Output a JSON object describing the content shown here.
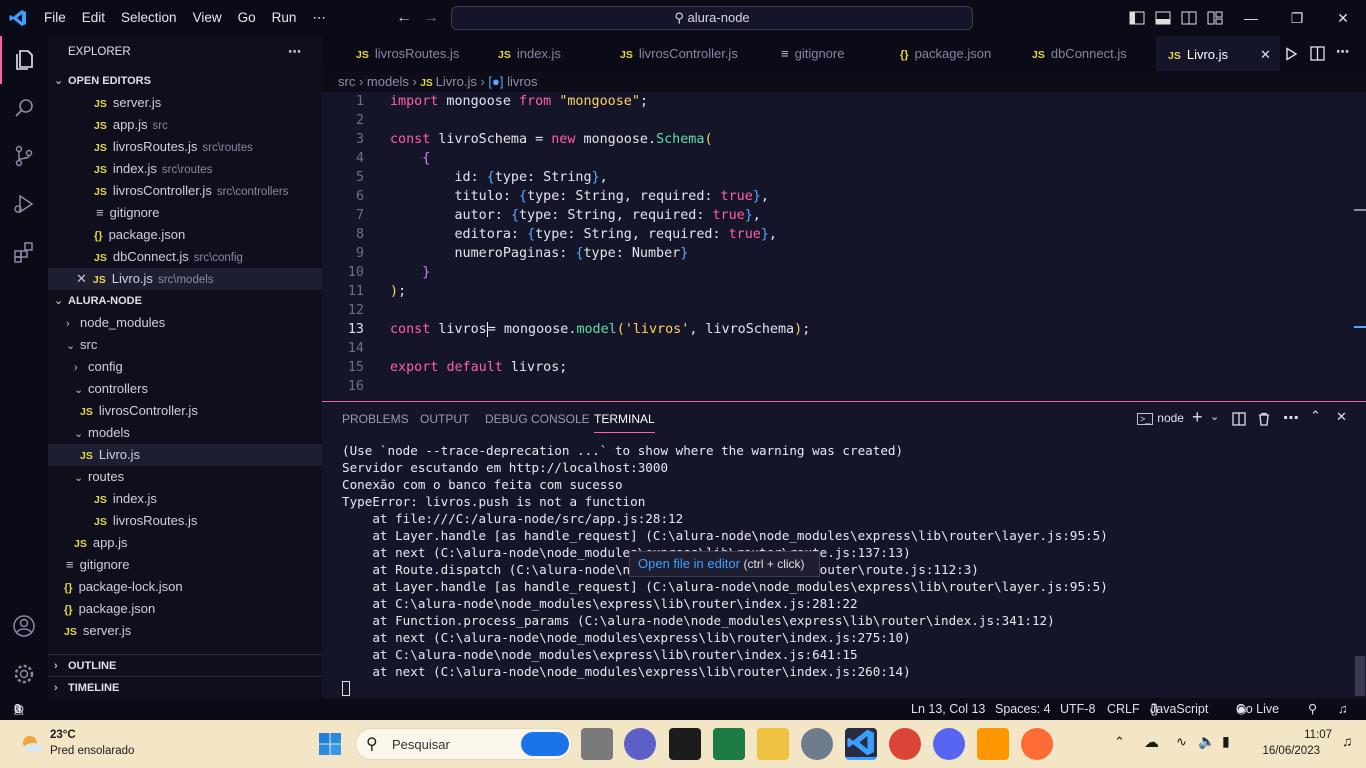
{
  "titlebar": {
    "menu": [
      "File",
      "Edit",
      "Selection",
      "View",
      "Go",
      "Run",
      "⋯"
    ],
    "search_text": "alura-node"
  },
  "sidebar": {
    "title": "EXPLORER",
    "open_editors_header": "OPEN EDITORS",
    "open_editors": [
      {
        "icon": "JS",
        "name": "server.js",
        "path": ""
      },
      {
        "icon": "JS",
        "name": "app.js",
        "path": "src"
      },
      {
        "icon": "JS",
        "name": "livrosRoutes.js",
        "path": "src\\routes"
      },
      {
        "icon": "JS",
        "name": "index.js",
        "path": "src\\routes"
      },
      {
        "icon": "JS",
        "name": "livrosController.js",
        "path": "src\\controllers"
      },
      {
        "icon": "≡",
        "name": "gitignore",
        "path": ""
      },
      {
        "icon": "{}",
        "name": "package.json",
        "path": ""
      },
      {
        "icon": "JS",
        "name": "dbConnect.js",
        "path": "src\\config"
      },
      {
        "icon": "JS",
        "name": "Livro.js",
        "path": "src\\models"
      }
    ],
    "project_header": "ALURA-NODE",
    "tree": [
      {
        "name": "node_modules",
        "type": "folder",
        "open": false,
        "depth": 0
      },
      {
        "name": "src",
        "type": "folder",
        "open": true,
        "depth": 0
      },
      {
        "name": "config",
        "type": "folder",
        "open": false,
        "depth": 1
      },
      {
        "name": "controllers",
        "type": "folder",
        "open": true,
        "depth": 1
      },
      {
        "name": "livrosController.js",
        "type": "js",
        "depth": 2
      },
      {
        "name": "models",
        "type": "folder",
        "open": true,
        "depth": 1
      },
      {
        "name": "Livro.js",
        "type": "js",
        "depth": 2
      },
      {
        "name": "routes",
        "type": "folder",
        "open": true,
        "depth": 1
      },
      {
        "name": "index.js",
        "type": "js",
        "depth": 2
      },
      {
        "name": "livrosRoutes.js",
        "type": "js",
        "depth": 2
      },
      {
        "name": "app.js",
        "type": "js",
        "depth": 1
      },
      {
        "name": "gitignore",
        "type": "text",
        "depth": 0
      },
      {
        "name": "package-lock.json",
        "type": "json",
        "depth": 0
      },
      {
        "name": "package.json",
        "type": "json",
        "depth": 0
      },
      {
        "name": "server.js",
        "type": "js",
        "depth": 0
      }
    ],
    "outline": "OUTLINE",
    "timeline": "TIMELINE"
  },
  "tabs": [
    {
      "icon": "JS",
      "label": "livrosRoutes.js"
    },
    {
      "icon": "JS",
      "label": "index.js"
    },
    {
      "icon": "JS",
      "label": "livrosController.js"
    },
    {
      "icon": "≡",
      "label": "gitignore"
    },
    {
      "icon": "{}",
      "label": "package.json"
    },
    {
      "icon": "JS",
      "label": "dbConnect.js"
    },
    {
      "icon": "JS",
      "label": "Livro.js"
    }
  ],
  "breadcrumb": {
    "a": "src",
    "b": "models",
    "c": "Livro.js",
    "d": "livros"
  },
  "editor": {
    "line_numbers": [
      "1",
      "2",
      "3",
      "4",
      "5",
      "6",
      "7",
      "8",
      "9",
      "10",
      "11",
      "12",
      "13",
      "14",
      "15",
      "16"
    ]
  },
  "panel": {
    "tabs": [
      "PROBLEMS",
      "OUTPUT",
      "DEBUG CONSOLE",
      "TERMINAL"
    ],
    "terminal_name": "node",
    "lines": [
      "(Use `node --trace-deprecation ...` to show where the warning was created)",
      "Servidor escutando em http://localhost:3000",
      "Conexão com o banco feita com sucesso",
      "TypeError: livros.push is not a function",
      "    at file:///C:/alura-node/src/app.js:28:12",
      "    at Layer.handle [as handle_request] (C:\\alura-node\\node_modules\\express\\lib\\router\\layer.js:95:5)",
      "    at next (C:\\alura-node\\node_modules\\express\\lib\\router\\route.js:137:13)",
      "    at Route.dispatch (C:\\alura-node\\node_modules\\express\\lib\\router\\route.js:112:3)",
      "    at Layer.handle [as handle_request] (C:\\alura-node\\node_modules\\express\\lib\\router\\layer.js:95:5)",
      "    at C:\\alura-node\\node_modules\\express\\lib\\router\\index.js:281:22",
      "    at Function.process_params (C:\\alura-node\\node_modules\\express\\lib\\router\\index.js:341:12)",
      "    at next (C:\\alura-node\\node_modules\\express\\lib\\router\\index.js:275:10)",
      "    at C:\\alura-node\\node_modules\\express\\lib\\router\\index.js:641:15",
      "    at next (C:\\alura-node\\node_modules\\express\\lib\\router\\index.js:260:14)"
    ],
    "tooltip_text": "Open file in editor",
    "tooltip_hint": "(ctrl + click)"
  },
  "status": {
    "errors": "0",
    "warnings": "0",
    "position": "Ln 13, Col 13",
    "spaces": "Spaces: 4",
    "encoding": "UTF-8",
    "eol": "CRLF",
    "language": "JavaScript",
    "golive": "Go Live"
  },
  "taskbar": {
    "temp": "23°C",
    "weather": "Pred ensolarado",
    "search": "Pesquisar",
    "time": "11:07",
    "date": "16/06/2023"
  },
  "colors": {
    "accent": "#ff5fa8",
    "vscode_blue": "#3aa0ff",
    "js_yellow": "#e6d84a"
  }
}
